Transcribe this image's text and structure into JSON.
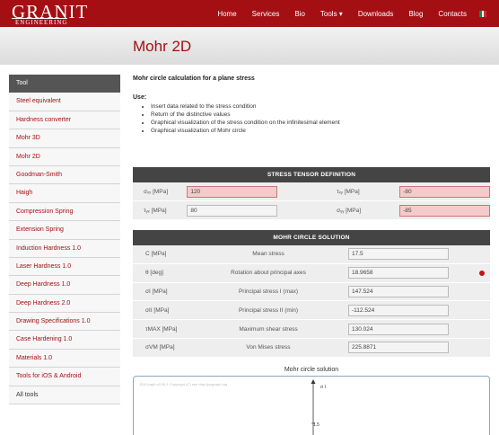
{
  "brand": {
    "name": "GRANIT",
    "tagline": "ENGINEERING"
  },
  "nav": [
    "Home",
    "Services",
    "Bio",
    "Tools ▾",
    "Downloads",
    "Blog",
    "Contacts"
  ],
  "flag_colors": [
    "#009246",
    "#ffffff",
    "#ce2b37"
  ],
  "page_title": "Mohr 2D",
  "sidebar": {
    "header": "Tool",
    "items": [
      "Steel equivalent",
      "Hardness converter",
      "Mohr 3D",
      "Mohr 2D",
      "Goodman-Smith",
      "Haigh",
      "Compression Spring",
      "Extension Spring",
      "Induction Hardness 1.0",
      "Laser Hardness 1.0",
      "Deep Hardness 1.0",
      "Deep Hardness 2.0",
      "Drawing Specifications 1.0",
      "Case Hardening 1.0",
      "Materials 1.0",
      "Tools for iOS & Android",
      "All tools"
    ]
  },
  "intro": {
    "heading": "Mohr circle calculation for a plane stress",
    "use_label": "Use:",
    "uses": [
      "Insert data related to the stress condition",
      "Return of the distinctive values",
      "Graphical visualization of the stress condition on the infinitesimal element",
      "Graphical visualization of Mohr circle"
    ]
  },
  "stress_tensor": {
    "header": "STRESS TENSOR DEFINITION",
    "rows": [
      {
        "l1": "σₓₓ [MPa]",
        "v1": "120",
        "l2": "τₓᵧ [MPa]",
        "v2": "-80",
        "red2": true
      },
      {
        "l1": "τᵧₓ [MPa]",
        "v1": "80",
        "l2": "σᵧᵧ [MPa]",
        "v2": "-85",
        "red2": true
      }
    ]
  },
  "mohr_solution": {
    "header": "MOHR CIRCLE SOLUTION",
    "rows": [
      {
        "label": "C [MPa]",
        "desc": "Mean stress",
        "value": "17.5"
      },
      {
        "label": "θ [deg]",
        "desc": "Rotation about principal axes",
        "value": "18.9658",
        "info": true
      },
      {
        "label": "σI [MPa]",
        "desc": "Principal stress I (max)",
        "value": "147.524"
      },
      {
        "label": "σII [MPa]",
        "desc": "Principal stress II (min)",
        "value": "-112.524"
      },
      {
        "label": "τMAX [MPa]",
        "desc": "Maximum shear stress",
        "value": "130.024"
      },
      {
        "label": "σVM [MPa]",
        "desc": "Von Mises stress",
        "value": "225.8871"
      }
    ]
  },
  "chart": {
    "title": "Mohr circle solution",
    "watermark": "JSXGraph v0.99.1 Copyright (C) see http://jsxgraph.org",
    "axis_label": "σ I",
    "tick": "1.5"
  }
}
